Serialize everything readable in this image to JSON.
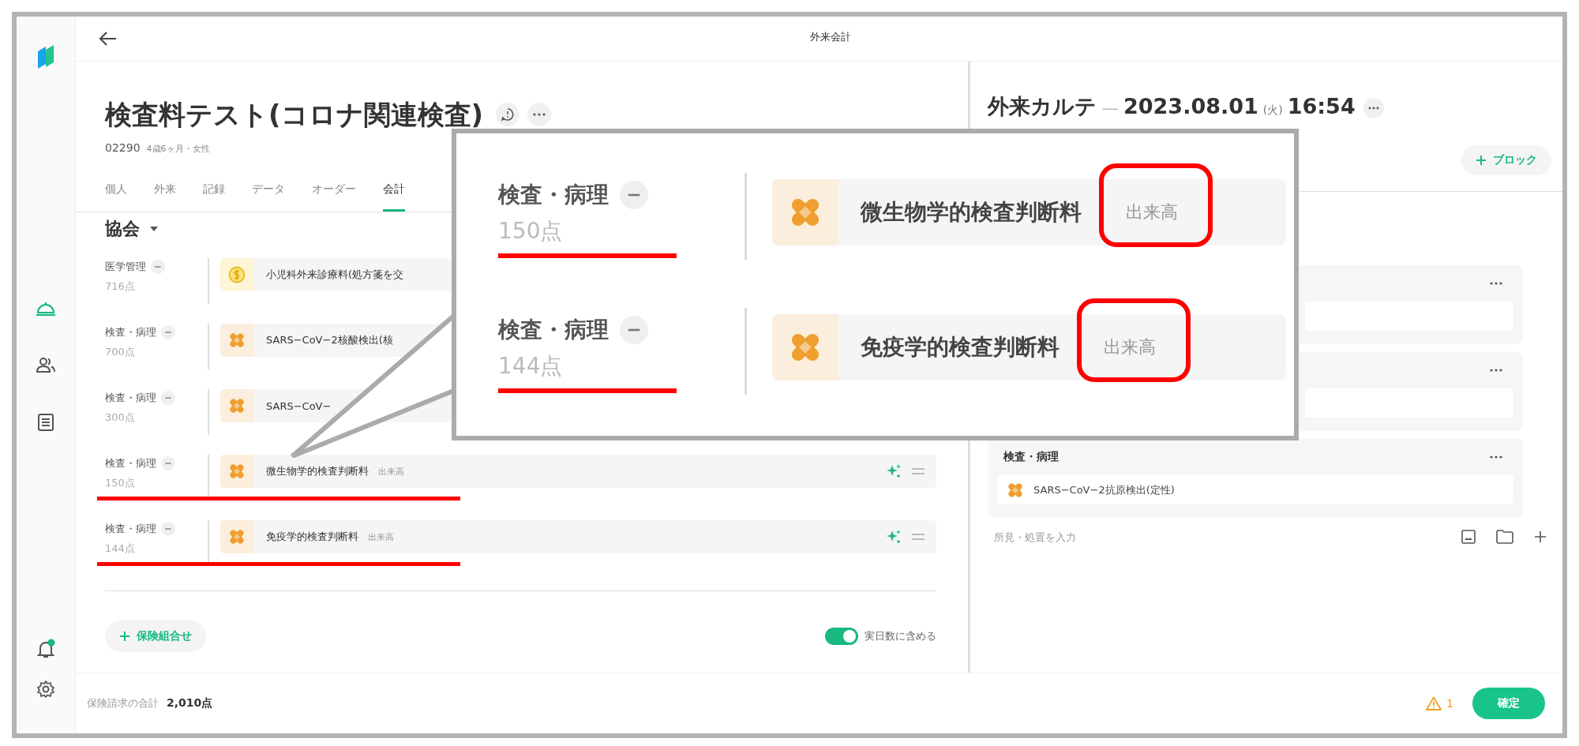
{
  "header": {
    "title": "外来会計"
  },
  "sidebar": {
    "nav": [
      {
        "selected": true
      },
      {
        "selected": false
      },
      {
        "selected": false
      }
    ],
    "notification_badge": true
  },
  "patient": {
    "name": "検査料テスト(コロナ関連検査)",
    "id": "02290",
    "details": "4歳6ヶ月・女性"
  },
  "tabs": [
    {
      "label": "個人",
      "selected": false
    },
    {
      "label": "外来",
      "selected": false
    },
    {
      "label": "記録",
      "selected": false
    },
    {
      "label": "データ",
      "selected": false
    },
    {
      "label": "オーダー",
      "selected": false
    },
    {
      "label": "会計",
      "selected": true
    }
  ],
  "insurer": {
    "label": "協会"
  },
  "billing_rows": [
    {
      "category": "医学管理",
      "points": "716点",
      "item": "小児科外来診療料(処方箋を交",
      "kind": "coin",
      "highlighted": false
    },
    {
      "category": "検査・病理",
      "points": "700点",
      "item": "SARS−CoV−2核酸検出(核",
      "kind": "test",
      "highlighted": false
    },
    {
      "category": "検査・病理",
      "points": "300点",
      "item": "SARS−CoV−",
      "kind": "test",
      "highlighted": false
    },
    {
      "category": "検査・病理",
      "points": "150点",
      "item": "微生物学的検査判断料",
      "tag": "出来高",
      "kind": "test",
      "highlighted": true
    },
    {
      "category": "検査・病理",
      "points": "144点",
      "item": "免疫学的検査判断料",
      "tag": "出来高",
      "kind": "test",
      "highlighted": true
    }
  ],
  "add_combination": {
    "label": "保険組合せ"
  },
  "include_days": {
    "label": "実日数に含める",
    "on": true
  },
  "callout": {
    "rows": [
      {
        "category": "検査・病理",
        "points": "150点",
        "item": "微生物学的検査判断料",
        "tag": "出来高",
        "highlighted": true
      },
      {
        "category": "検査・病理",
        "points": "144点",
        "item": "免疫学的検査判断料",
        "tag": "出来高",
        "highlighted": true
      }
    ]
  },
  "record": {
    "title": "外来カルテ",
    "separator": "—",
    "date": "2023.08.01",
    "weekday": "(火)",
    "time": "16:54",
    "add_block": "ブロック",
    "cards": [
      {
        "kind": "covered"
      },
      {
        "kind": "covered"
      },
      {
        "kind": "entry",
        "title": "検査・病理",
        "items": [
          "SARS−CoV−2抗原検出(定性)"
        ]
      }
    ],
    "note_placeholder": "所見・処置を入力"
  },
  "footer": {
    "total_label": "保険請求の合計",
    "total": "2,010点",
    "warning_count": "1",
    "confirm": "確定"
  }
}
